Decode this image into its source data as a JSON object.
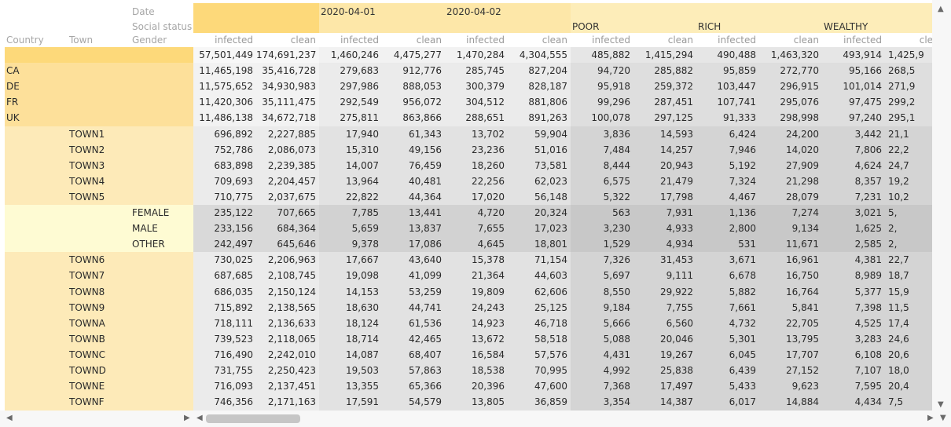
{
  "row_dims": {
    "country": "Country",
    "town": "Town",
    "gender": "Gender"
  },
  "col_dims": {
    "date": "Date",
    "social_status": "Social status"
  },
  "dates": [
    "2020-04-01",
    "2020-04-02"
  ],
  "statuses": [
    "POOR",
    "RICH",
    "WEALTHY"
  ],
  "metrics": [
    "infected",
    "clean"
  ],
  "colors": {
    "header_gold": "#fdd97a",
    "header_light": "#fdedb9",
    "row_label_light": "#fdeab8",
    "row_label_gold": "#fde09a",
    "cell_light": "#ececec",
    "cell_mid": "#dcdcdc",
    "cell_dark": "#cfcfcf",
    "total_row": "#f5f5f5"
  },
  "rows": [
    {
      "country": "",
      "town": "",
      "gender": "",
      "values": [
        "57,501,449",
        "174,691,237",
        "1,460,246",
        "4,475,277",
        "1,470,284",
        "4,304,555",
        "485,882",
        "1,415,294",
        "490,488",
        "1,463,320",
        "493,914",
        "1,425,9"
      ]
    },
    {
      "country": "CA",
      "town": "",
      "gender": "",
      "values": [
        "11,465,198",
        "35,416,728",
        "279,683",
        "912,776",
        "285,745",
        "827,204",
        "94,720",
        "285,882",
        "95,859",
        "272,770",
        "95,166",
        "268,5"
      ]
    },
    {
      "country": "DE",
      "town": "",
      "gender": "",
      "values": [
        "11,575,652",
        "34,930,983",
        "297,986",
        "888,053",
        "300,379",
        "828,187",
        "95,918",
        "259,372",
        "103,447",
        "296,915",
        "101,014",
        "271,9"
      ]
    },
    {
      "country": "FR",
      "town": "",
      "gender": "",
      "values": [
        "11,420,306",
        "35,111,475",
        "292,549",
        "956,072",
        "304,512",
        "881,806",
        "99,296",
        "287,451",
        "107,741",
        "295,076",
        "97,475",
        "299,2"
      ]
    },
    {
      "country": "UK",
      "town": "",
      "gender": "",
      "values": [
        "11,486,138",
        "34,672,718",
        "275,811",
        "863,866",
        "288,651",
        "891,263",
        "100,078",
        "297,125",
        "91,333",
        "298,998",
        "97,240",
        "295,1"
      ]
    },
    {
      "country": "",
      "town": "TOWN1",
      "gender": "",
      "values": [
        "696,892",
        "2,227,885",
        "17,940",
        "61,343",
        "13,702",
        "59,904",
        "3,836",
        "14,593",
        "6,424",
        "24,200",
        "3,442",
        "21,1"
      ]
    },
    {
      "country": "",
      "town": "TOWN2",
      "gender": "",
      "values": [
        "752,786",
        "2,086,073",
        "15,310",
        "49,156",
        "23,236",
        "51,016",
        "7,484",
        "14,257",
        "7,946",
        "14,020",
        "7,806",
        "22,2"
      ]
    },
    {
      "country": "",
      "town": "TOWN3",
      "gender": "",
      "values": [
        "683,898",
        "2,239,385",
        "14,007",
        "76,459",
        "18,260",
        "73,581",
        "8,444",
        "20,943",
        "5,192",
        "27,909",
        "4,624",
        "24,7"
      ]
    },
    {
      "country": "",
      "town": "TOWN4",
      "gender": "",
      "values": [
        "709,693",
        "2,204,457",
        "13,964",
        "40,481",
        "22,256",
        "62,023",
        "6,575",
        "21,479",
        "7,324",
        "21,298",
        "8,357",
        "19,2"
      ]
    },
    {
      "country": "",
      "town": "TOWN5",
      "gender": "",
      "values": [
        "710,775",
        "2,037,675",
        "22,822",
        "44,364",
        "17,020",
        "56,148",
        "5,322",
        "17,798",
        "4,467",
        "28,079",
        "7,231",
        "10,2"
      ]
    },
    {
      "country": "",
      "town": "",
      "gender": "FEMALE",
      "values": [
        "235,122",
        "707,665",
        "7,785",
        "13,441",
        "4,720",
        "20,324",
        "563",
        "7,931",
        "1,136",
        "7,274",
        "3,021",
        "5,"
      ]
    },
    {
      "country": "",
      "town": "",
      "gender": "MALE",
      "values": [
        "233,156",
        "684,364",
        "5,659",
        "13,837",
        "7,655",
        "17,023",
        "3,230",
        "4,933",
        "2,800",
        "9,134",
        "1,625",
        "2,"
      ]
    },
    {
      "country": "",
      "town": "",
      "gender": "OTHER",
      "values": [
        "242,497",
        "645,646",
        "9,378",
        "17,086",
        "4,645",
        "18,801",
        "1,529",
        "4,934",
        "531",
        "11,671",
        "2,585",
        "2,"
      ]
    },
    {
      "country": "",
      "town": "TOWN6",
      "gender": "",
      "values": [
        "730,025",
        "2,206,963",
        "17,667",
        "43,640",
        "15,378",
        "71,154",
        "7,326",
        "31,453",
        "3,671",
        "16,961",
        "4,381",
        "22,7"
      ]
    },
    {
      "country": "",
      "town": "TOWN7",
      "gender": "",
      "values": [
        "687,685",
        "2,108,745",
        "19,098",
        "41,099",
        "21,364",
        "44,603",
        "5,697",
        "9,111",
        "6,678",
        "16,750",
        "8,989",
        "18,7"
      ]
    },
    {
      "country": "",
      "town": "TOWN8",
      "gender": "",
      "values": [
        "686,035",
        "2,150,124",
        "14,153",
        "53,259",
        "19,809",
        "62,606",
        "8,550",
        "29,922",
        "5,882",
        "16,764",
        "5,377",
        "15,9"
      ]
    },
    {
      "country": "",
      "town": "TOWN9",
      "gender": "",
      "values": [
        "715,892",
        "2,138,565",
        "18,630",
        "44,741",
        "24,243",
        "25,125",
        "9,184",
        "7,755",
        "7,661",
        "5,841",
        "7,398",
        "11,5"
      ]
    },
    {
      "country": "",
      "town": "TOWNA",
      "gender": "",
      "values": [
        "718,111",
        "2,136,633",
        "18,124",
        "61,536",
        "14,923",
        "46,718",
        "5,666",
        "6,560",
        "4,732",
        "22,705",
        "4,525",
        "17,4"
      ]
    },
    {
      "country": "",
      "town": "TOWNB",
      "gender": "",
      "values": [
        "739,523",
        "2,118,065",
        "18,714",
        "42,465",
        "13,672",
        "58,518",
        "5,088",
        "20,046",
        "5,301",
        "13,795",
        "3,283",
        "24,6"
      ]
    },
    {
      "country": "",
      "town": "TOWNC",
      "gender": "",
      "values": [
        "716,490",
        "2,242,010",
        "14,087",
        "68,407",
        "16,584",
        "57,576",
        "4,431",
        "19,267",
        "6,045",
        "17,707",
        "6,108",
        "20,6"
      ]
    },
    {
      "country": "",
      "town": "TOWND",
      "gender": "",
      "values": [
        "731,755",
        "2,250,423",
        "19,503",
        "57,863",
        "18,538",
        "70,995",
        "4,992",
        "25,838",
        "6,439",
        "27,152",
        "7,107",
        "18,0"
      ]
    },
    {
      "country": "",
      "town": "TOWNE",
      "gender": "",
      "values": [
        "716,093",
        "2,137,451",
        "13,355",
        "65,366",
        "20,396",
        "47,600",
        "7,368",
        "17,497",
        "5,433",
        "9,623",
        "7,595",
        "20,4"
      ]
    },
    {
      "country": "",
      "town": "TOWNF",
      "gender": "",
      "values": [
        "746,356",
        "2,171,163",
        "17,591",
        "54,579",
        "13,805",
        "36,859",
        "3,354",
        "14,387",
        "6,017",
        "14,884",
        "4,434",
        "7,5"
      ]
    }
  ]
}
